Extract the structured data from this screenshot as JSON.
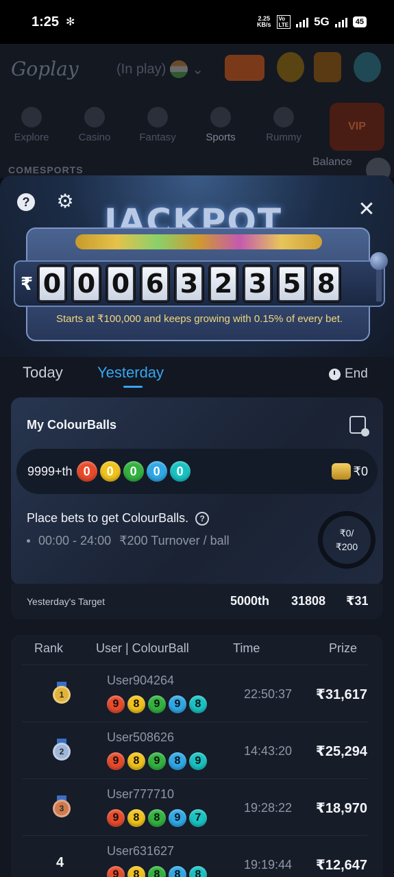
{
  "status_bar": {
    "time": "1:25",
    "speed_value": "2.25",
    "speed_unit": "KB/s",
    "network_label": "5G",
    "battery": "45"
  },
  "app_header": {
    "logo_text": "Goplay",
    "in_play_label": "(In play)",
    "nav": [
      {
        "label": "Explore"
      },
      {
        "label": "Casino"
      },
      {
        "label": "Fantasy"
      },
      {
        "label": "Sports"
      },
      {
        "label": "Rummy"
      }
    ],
    "vip_label": "VIP",
    "comesports_label": "COMESPORTS",
    "balance_label": "Balance"
  },
  "jackpot": {
    "title": "JACKPOT",
    "currency_symbol": "₹",
    "digits": [
      "0",
      "0",
      "0",
      "6",
      "3",
      "2",
      "3",
      "5",
      "8"
    ],
    "tagline": "Starts at ₹100,000 and keeps growing with 0.15% of every bet."
  },
  "tabs": {
    "today": "Today",
    "yesterday": "Yesterday",
    "active": "yesterday",
    "end_label": "End"
  },
  "my_colourballs": {
    "title": "My ColourBalls",
    "rank": "9999+th",
    "balls": [
      {
        "value": "0",
        "color": "#e84b2c"
      },
      {
        "value": "0",
        "color": "#f0c21b"
      },
      {
        "value": "0",
        "color": "#32b33f"
      },
      {
        "value": "0",
        "color": "#2fa8e8"
      },
      {
        "value": "0",
        "color": "#19c2c2"
      }
    ],
    "prize": "₹0",
    "place_bets_text": "Place bets to get ColourBalls.",
    "hours": "00:00 - 24:00",
    "turnover_rule": "₹200 Turnover / ball",
    "progress_current": "₹0/",
    "progress_target": "₹200",
    "progress_fraction": 0
  },
  "yesterday_target": {
    "label": "Yesterday's Target",
    "rank": "5000th",
    "score": "31808",
    "prize": "₹31"
  },
  "leaderboard": {
    "headers": {
      "rank": "Rank",
      "user": "User | ColourBall",
      "time": "Time",
      "prize": "Prize"
    },
    "rows": [
      {
        "rank": "1",
        "user": "User904264",
        "balls": [
          "9",
          "8",
          "9",
          "9",
          "8"
        ],
        "time": "22:50:37",
        "prize": "₹31,617"
      },
      {
        "rank": "2",
        "user": "User508626",
        "balls": [
          "9",
          "8",
          "9",
          "8",
          "9"
        ],
        "time": "14:43:20",
        "prize": "₹25,294"
      },
      {
        "rank": "3",
        "user": "User777710",
        "balls": [
          "9",
          "8",
          "8",
          "9",
          "7"
        ],
        "time": "19:28:22",
        "prize": "₹18,970"
      },
      {
        "rank": "4",
        "user": "User631627",
        "balls": [
          "9",
          "8",
          "8",
          "8",
          "8"
        ],
        "time": "19:19:44",
        "prize": "₹12,647"
      }
    ],
    "ball_colors": [
      "#e84b2c",
      "#f0c21b",
      "#32b33f",
      "#2fa8e8",
      "#19c2c2"
    ],
    "medal_colors": [
      "#e2b33a",
      "#9fb6d8",
      "#d07a4e"
    ]
  },
  "icons": {
    "help": "help-icon",
    "settings": "gear-icon",
    "close": "close-icon",
    "history": "history-icon",
    "timer": "timer-icon",
    "coins": "coin-stack-icon"
  }
}
